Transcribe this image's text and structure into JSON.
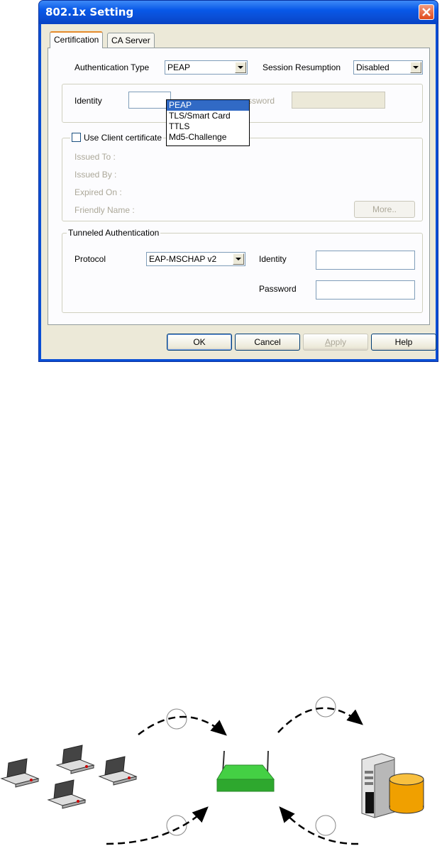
{
  "window": {
    "title": "802.1x Setting"
  },
  "tabs": [
    {
      "label": "Certification"
    },
    {
      "label": "CA Server"
    }
  ],
  "auth": {
    "type_label": "Authentication Type",
    "type_value": "PEAP",
    "session_label": "Session Resumption",
    "session_value": "Disabled",
    "options": [
      "PEAP",
      "TLS/Smart Card",
      "TTLS",
      "Md5-Challenge"
    ]
  },
  "identity": {
    "label": "Identity",
    "password_label_partial": "ssword"
  },
  "client_cert": {
    "checkbox_label": "Use Client certificate",
    "issued_to": "Issued To :",
    "issued_by": "Issued By :",
    "expired_on": "Expired On :",
    "friendly_name": "Friendly Name :",
    "more_button": "More.."
  },
  "tunneled": {
    "group_title": "Tunneled Authentication",
    "protocol_label": "Protocol",
    "protocol_value": "EAP-MSCHAP v2",
    "identity_label": "Identity",
    "password_label": "Password"
  },
  "buttons": {
    "ok": "OK",
    "cancel": "Cancel",
    "apply_prefix": "A",
    "apply_rest": "pply",
    "help": "Help"
  },
  "colors": {
    "titlebar": "#0a4fd6",
    "access_point": "#3cc43c",
    "database": "#f0a000",
    "selection": "#316ac5"
  }
}
